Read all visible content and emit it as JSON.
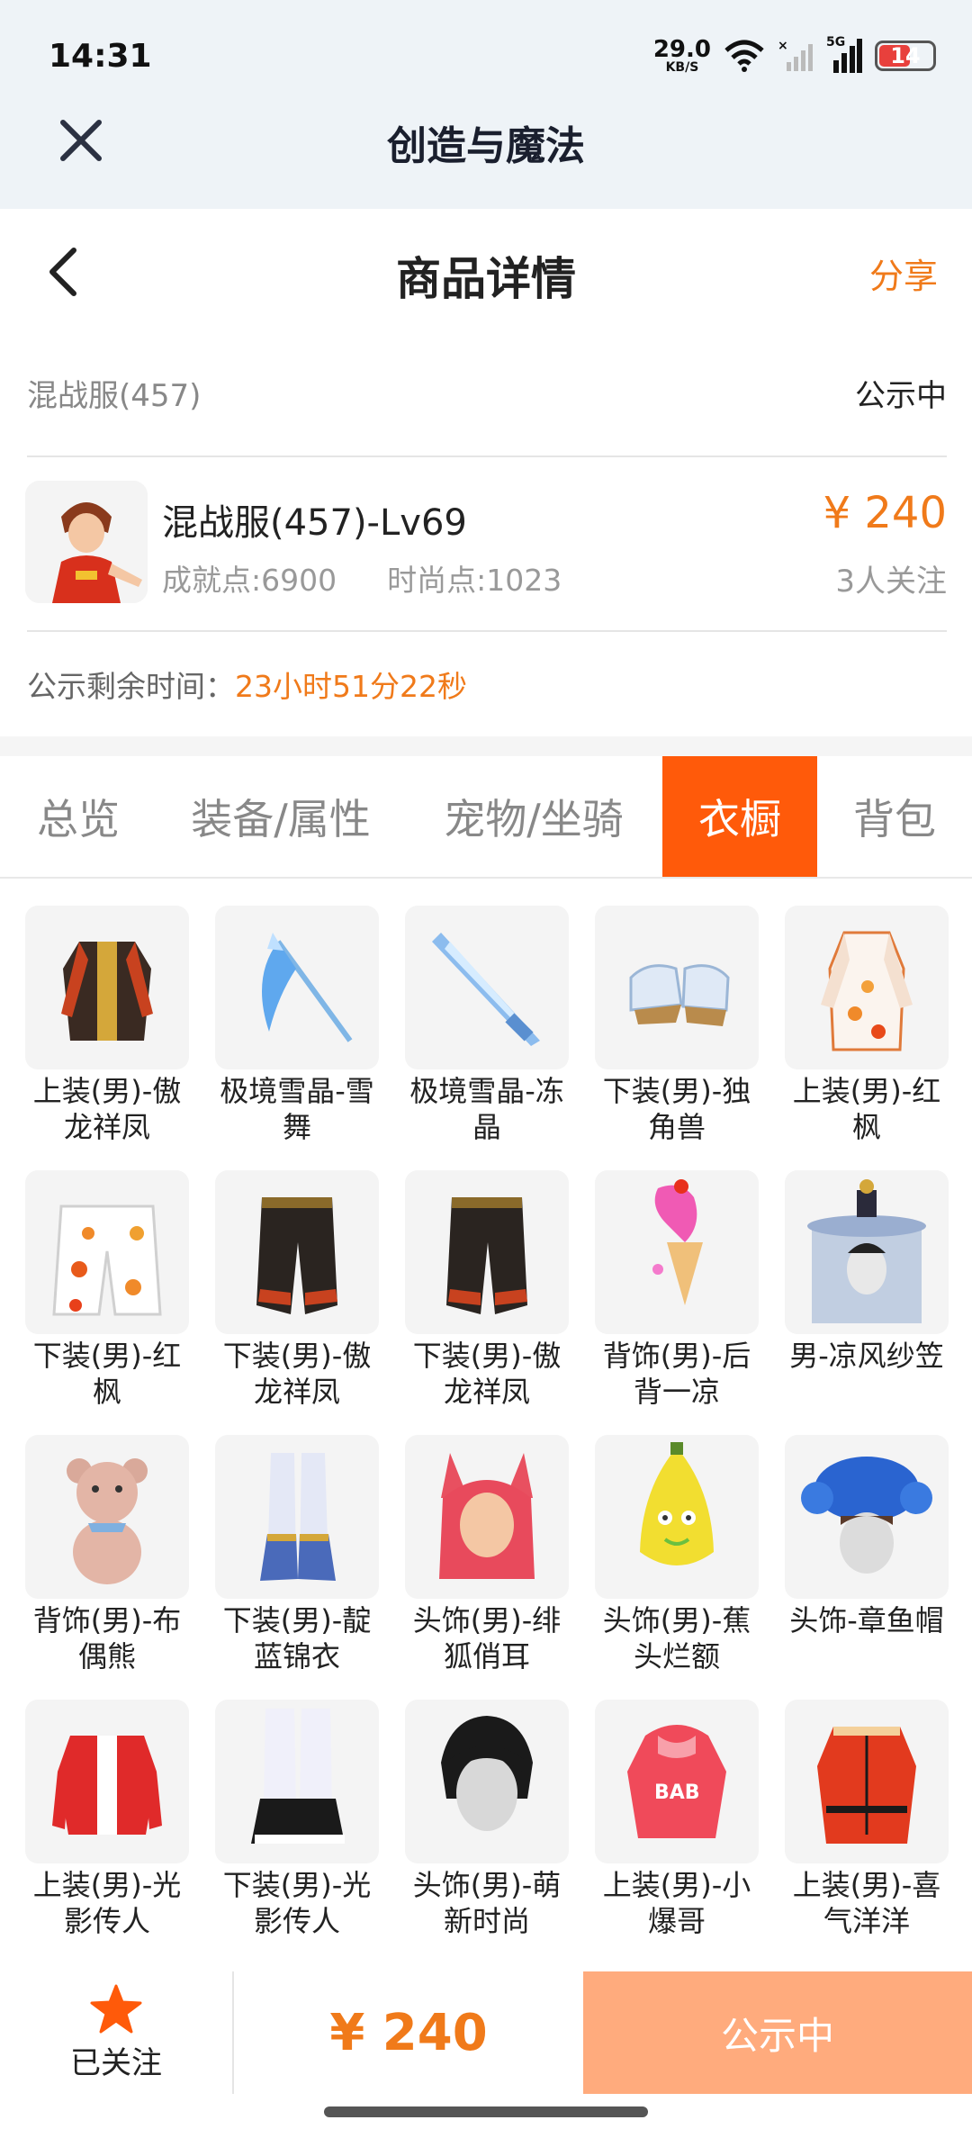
{
  "status_bar": {
    "time": "14:31",
    "speed_value": "29.0",
    "speed_unit": "KB/S",
    "network": "5G",
    "battery": "14"
  },
  "app_header": {
    "title": "创造与魔法"
  },
  "page_header": {
    "title": "商品详情",
    "share_label": "分享"
  },
  "server": {
    "name": "混战服(457)",
    "status": "公示中"
  },
  "product": {
    "name": "混战服(457)-Lv69",
    "achievement": "成就点:6900",
    "fashion": "时尚点:1023",
    "price": "¥ 240",
    "watchers": "3人关注"
  },
  "timer": {
    "label": "公示剩余时间：",
    "value": "23小时51分22秒"
  },
  "tabs": [
    {
      "label": "总览",
      "active": false
    },
    {
      "label": "装备/属性",
      "active": false
    },
    {
      "label": "宠物/坐骑",
      "active": false
    },
    {
      "label": "衣橱",
      "active": true
    },
    {
      "label": "背包",
      "active": false
    }
  ],
  "wardrobe": [
    {
      "label": "上装(男)-傲龙祥凤",
      "icon": "dragon-robe-icon"
    },
    {
      "label": "极境雪晶-雪舞",
      "icon": "ice-scythe-icon"
    },
    {
      "label": "极境雪晶-冻晶",
      "icon": "ice-sword-icon"
    },
    {
      "label": "下装(男)-独角兽",
      "icon": "unicorn-boots-icon"
    },
    {
      "label": "上装(男)-红枫",
      "icon": "maple-robe-icon"
    },
    {
      "label": "下装(男)-红枫",
      "icon": "maple-pants-icon"
    },
    {
      "label": "下装(男)-傲龙祥凤",
      "icon": "dragon-pants-icon"
    },
    {
      "label": "下装(男)-傲龙祥凤",
      "icon": "dragon-pants-icon"
    },
    {
      "label": "背饰(男)-后背一凉",
      "icon": "icecream-back-icon"
    },
    {
      "label": "男-凉风纱笠",
      "icon": "veil-hat-icon"
    },
    {
      "label": "背饰(男)-布偶熊",
      "icon": "teddy-bear-icon"
    },
    {
      "label": "下装(男)-靛蓝锦衣",
      "icon": "indigo-boots-icon"
    },
    {
      "label": "头饰(男)-绯狐俏耳",
      "icon": "fox-ears-icon"
    },
    {
      "label": "头饰(男)-蕉头烂额",
      "icon": "banana-head-icon"
    },
    {
      "label": "头饰-章鱼帽",
      "icon": "octopus-hat-icon"
    },
    {
      "label": "上装(男)-光影传人",
      "icon": "red-jacket-icon"
    },
    {
      "label": "下装(男)-光影传人",
      "icon": "white-boots-icon"
    },
    {
      "label": "头饰(男)-萌新时尚",
      "icon": "black-hair-icon"
    },
    {
      "label": "上装(男)-小爆哥",
      "icon": "pink-hoodie-icon"
    },
    {
      "label": "上装(男)-喜气洋洋",
      "icon": "red-tang-suit-icon"
    }
  ],
  "bottom_bar": {
    "follow_label": "已关注",
    "price": "¥ 240",
    "action_label": "公示中"
  },
  "colors": {
    "accent": "#f07a1a",
    "tab_active": "#ff5a0a",
    "action_bg": "#ffab7d"
  }
}
